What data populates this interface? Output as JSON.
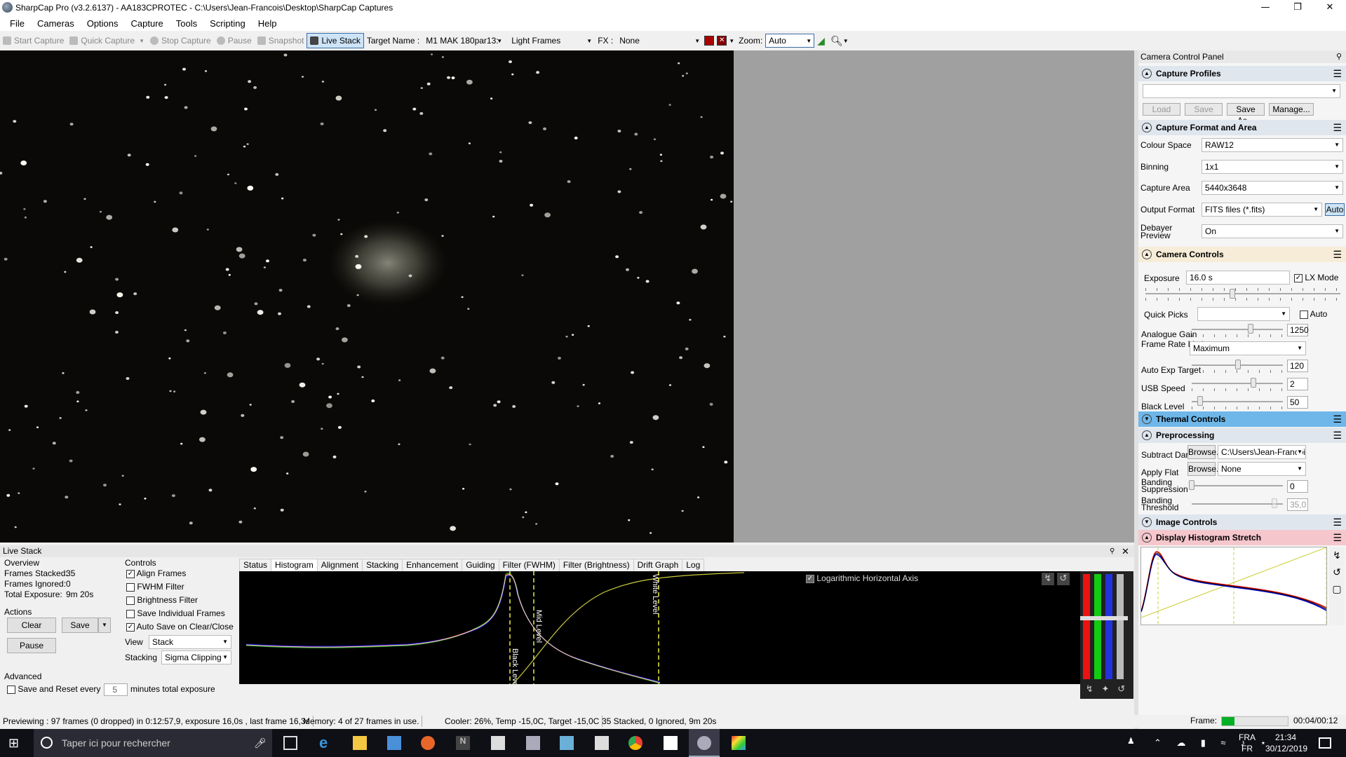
{
  "window": {
    "title": "SharpCap Pro (v3.2.6137) - AA183CPROTEC - C:\\Users\\Jean-Francois\\Desktop\\SharpCap Captures"
  },
  "menu": [
    "File",
    "Cameras",
    "Options",
    "Capture",
    "Tools",
    "Scripting",
    "Help"
  ],
  "toolbar": {
    "start_capture": "Start Capture",
    "quick_capture": "Quick Capture",
    "stop_capture": "Stop Capture",
    "pause": "Pause",
    "snapshot": "Snapshot",
    "live_stack": "Live Stack",
    "target_label": "Target Name :",
    "target_value": "M1 MAK 180par13:",
    "frame_type": "Light Frames",
    "fx_label": "FX :",
    "fx_value": "None",
    "zoom_label": "Zoom:",
    "zoom_value": "Auto"
  },
  "panel": {
    "title": "Camera Control Panel",
    "capture_profiles": {
      "header": "Capture Profiles",
      "load": "Load",
      "save": "Save",
      "save_as": "Save As...",
      "manage": "Manage..."
    },
    "format": {
      "header": "Capture Format and Area",
      "colour_space_label": "Colour Space",
      "colour_space": "RAW12",
      "binning_label": "Binning",
      "binning": "1x1",
      "area_label": "Capture Area",
      "area": "5440x3648",
      "output_label": "Output Format",
      "output": "FITS files (*.fits)",
      "auto": "Auto",
      "debayer_label": "Debayer Preview",
      "debayer": "On"
    },
    "camera": {
      "header": "Camera Controls",
      "exposure_label": "Exposure",
      "exposure": "16.0 s",
      "lx_mode": "LX Mode",
      "quick_picks": "Quick Picks",
      "auto": "Auto",
      "gain_label": "Analogue Gain",
      "gain": "1250",
      "frame_rate_label": "Frame Rate Limit",
      "frame_rate": "Maximum",
      "auto_exp_label": "Auto Exp Target",
      "auto_exp": "120",
      "usb_label": "USB Speed",
      "usb": "2",
      "black_label": "Black Level",
      "black": "50"
    },
    "thermal": {
      "header": "Thermal Controls"
    },
    "pre": {
      "header": "Preprocessing",
      "dark_label": "Subtract Dark",
      "browse": "Browse...",
      "dark": "C:\\Users\\Jean-Francois\\...",
      "flat_label": "Apply Flat",
      "flat": "None",
      "band_sup_label": "Banding Suppression",
      "band_sup": "0",
      "band_thr_label": "Banding Threshold",
      "band_thr": "35,0"
    },
    "image": {
      "header": "Image Controls"
    },
    "stretch": {
      "header": "Display Histogram Stretch"
    }
  },
  "livestack": {
    "title": "Live Stack",
    "overview": "Overview",
    "frames_stacked_label": "Frames Stacked:",
    "frames_stacked": "35",
    "frames_ignored_label": "Frames Ignored:",
    "frames_ignored": "0",
    "total_exposure_label": "Total Exposure:",
    "total_exposure": "9m 20s",
    "actions": "Actions",
    "clear": "Clear",
    "save": "Save",
    "pause": "Pause",
    "advanced": "Advanced",
    "save_reset": "Save and Reset every",
    "save_reset_value": "5",
    "minutes": "minutes total exposure",
    "controls": "Controls",
    "align": "Align Frames",
    "fwhm": "FWHM Filter",
    "brightness": "Brightness Filter",
    "save_indiv": "Save Individual Frames",
    "auto_save": "Auto Save on Clear/Close",
    "view_label": "View",
    "view": "Stack",
    "stacking_label": "Stacking",
    "stacking": "Sigma Clipping",
    "tabs": [
      "Status",
      "Histogram",
      "Alignment",
      "Stacking",
      "Enhancement",
      "Guiding",
      "Filter (FWHM)",
      "Filter (Brightness)",
      "Drift Graph",
      "Log"
    ],
    "log_axis": "Logarithmic Horizontal Axis",
    "black_level": "Black Level",
    "mid_level": "Mid Level",
    "white_level": "White Level"
  },
  "status": {
    "preview": "Previewing : 97 frames (0 dropped) in 0:12:57,9, exposure 16,0s , last frame 16,3s",
    "memory": "Memory: 4 of 27 frames in use.",
    "cooler": "Cooler: 26%, Temp -15,0C, Target -15,0C",
    "stacked": "35 Stacked, 0 Ignored, 9m 20s",
    "frame_label": "Frame:",
    "time": "00:04/00:12"
  },
  "taskbar": {
    "search": "Taper ici pour rechercher",
    "lang1": "FRA",
    "lang2": "FR",
    "clock": "21:34",
    "date": "30/12/2019"
  }
}
